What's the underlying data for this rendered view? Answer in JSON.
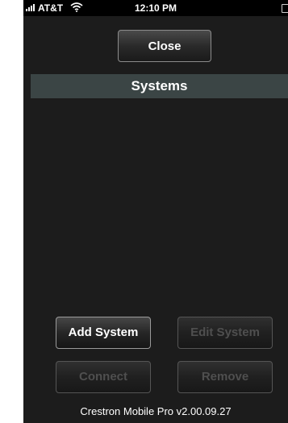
{
  "status_bar": {
    "carrier": "AT&T",
    "time": "12:10 PM",
    "signal_icon": "signal-bars-icon",
    "wifi_icon": "wifi-icon",
    "battery_icon": "battery-icon"
  },
  "toolbar": {
    "close_label": "Close"
  },
  "systems": {
    "header": "Systems",
    "items": []
  },
  "actions": {
    "add_system": "Add System",
    "edit_system": "Edit System",
    "connect": "Connect",
    "remove": "Remove"
  },
  "footer": {
    "version": "Crestron Mobile Pro v2.00.09.27"
  },
  "colors": {
    "background": "#1c1c1c",
    "header_bar": "#3b4545",
    "disabled_text": "#4f4f4f"
  }
}
